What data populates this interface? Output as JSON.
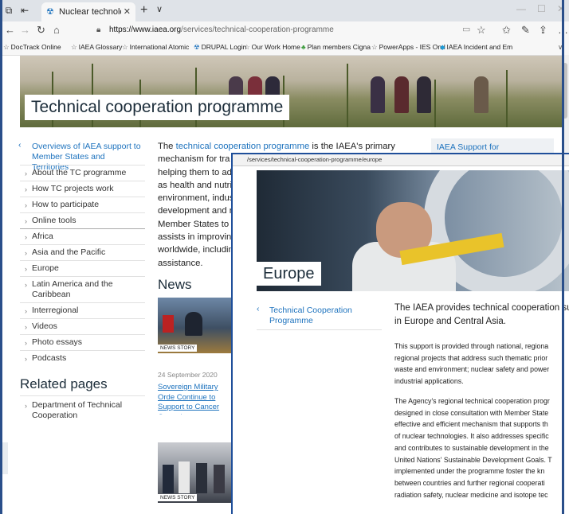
{
  "browser": {
    "tab_title": "Nuclear technology for",
    "url_host": "https://www.iaea.org",
    "url_path": "/services/technical-cooperation-programme",
    "favorites": [
      "DocTrack Online",
      "IAEA Glossary",
      "International Atomic",
      "DRUPAL Login",
      "Our Work Home",
      "Plan members Cigna",
      "PowerApps - IES On-l",
      "IAEA Incident and Em"
    ]
  },
  "page": {
    "hero_title": "Technical cooperation programme",
    "sidenav_first": "Overviews of IAEA support to Member States and Territories",
    "sidenav_items": [
      "About the TC programme",
      "How TC projects work",
      "How to participate",
      "Online tools",
      "Africa",
      "Asia and the Pacific",
      "Europe",
      "Latin America and the Caribbean",
      "Interregional",
      "Videos",
      "Photo essays",
      "Podcasts"
    ],
    "related_title": "Related pages",
    "related_item": "Department of Technical Cooperation",
    "intro_lead": "The ",
    "intro_link": "technical cooperation programme",
    "intro_rest": " is the IAEA's primary",
    "intro_lines": [
      "mechanism for tra",
      "helping them to ad",
      "as health and nutri",
      "environment, indus",
      "development and r",
      "Member States to",
      "assists in improving",
      "worldwide, includin",
      "assistance."
    ],
    "news_title": "News",
    "news_badge": "NEWS STORY",
    "news_date": "24 September 2020",
    "news_headline": "Sovereign Military Orde Continue to Support to Cancer Control",
    "news_badge2": "NEWS STORY",
    "aside_title": "IAEA Support for"
  },
  "overlay": {
    "url": "/services/technical-cooperation-programme/europe",
    "title": "Europe",
    "nav_item": "Technical Cooperation Programme",
    "lead_lines": [
      "The IAEA provides technical cooperation sup",
      "in Europe and Central Asia."
    ],
    "para1": [
      "This support is provided through national, regiona",
      "regional projects that address such thematic prior",
      "waste and environment; nuclear safety and power",
      "industrial applications."
    ],
    "para2": [
      "The Agency's regional technical cooperation progr",
      "designed in close consultation with Member State",
      "effective and efficient mechanism that supports th",
      "of nuclear technologies. It also addresses specific",
      "and contributes to sustainable development in the",
      "United Nations' Sustainable Development Goals. T",
      "implemented under the programme foster the kn",
      "between countries and further regional cooperati",
      "radiation safety, nuclear medicine and isotope tec"
    ]
  }
}
